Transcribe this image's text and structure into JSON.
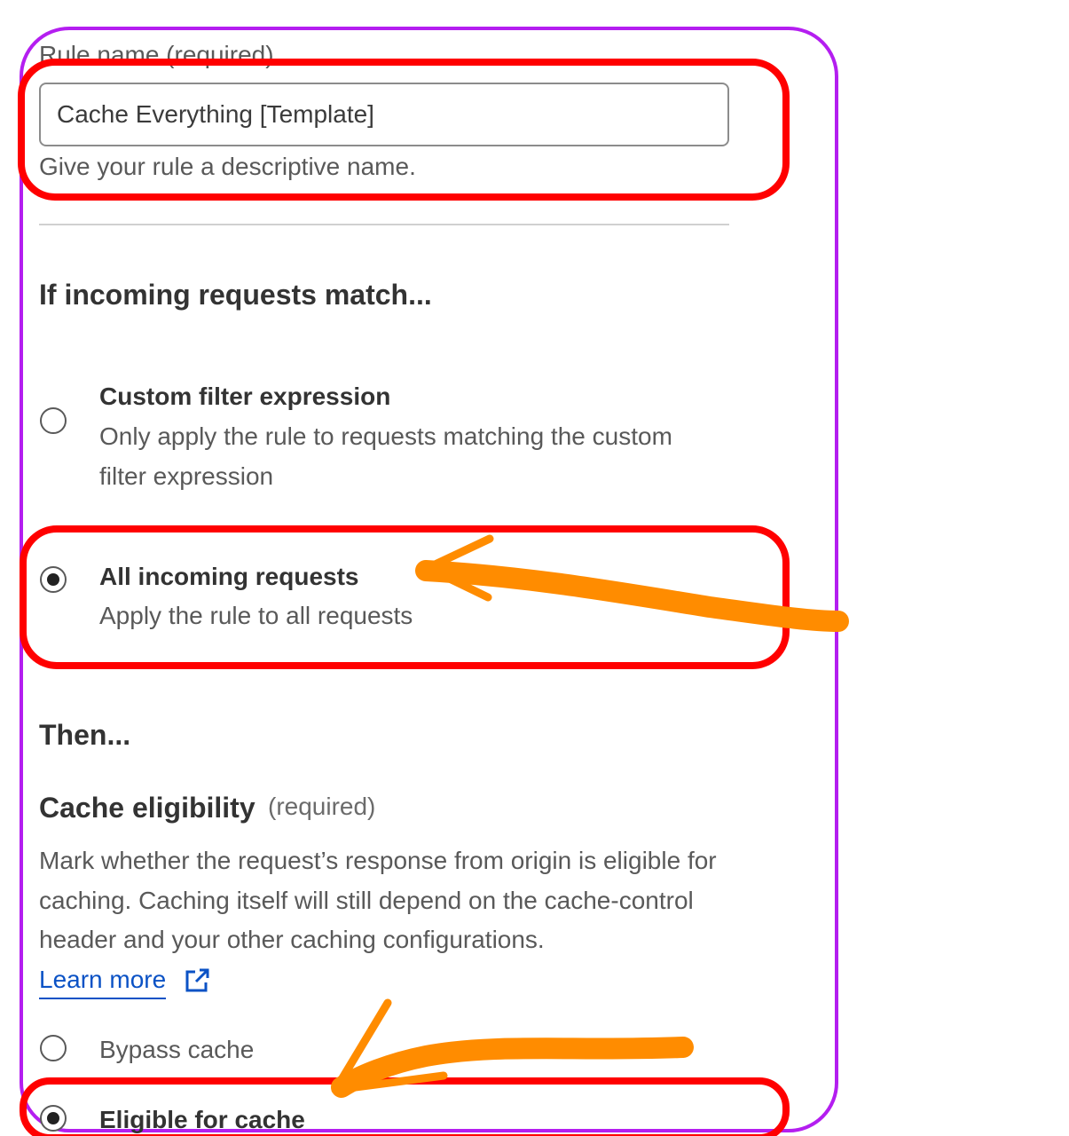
{
  "rule_name": {
    "label": "Rule name (required)",
    "value": "Cache Everything [Template]",
    "help": "Give your rule a descriptive name."
  },
  "match": {
    "heading": "If incoming requests match...",
    "options": [
      {
        "title": "Custom filter expression",
        "desc": "Only apply the rule to requests matching the custom filter expression",
        "selected": false
      },
      {
        "title": "All incoming requests",
        "desc": "Apply the rule to all requests",
        "selected": true
      }
    ]
  },
  "then": {
    "heading": "Then...",
    "cache_eligibility": {
      "title": "Cache eligibility",
      "required": "(required)",
      "description": "Mark whether the request’s response from origin is eligible for caching. Caching itself will still depend on the cache-control header and your other caching configurations.",
      "learn_more": "Learn more",
      "learn_more_icon": "external-link-icon",
      "options": [
        {
          "label": "Bypass cache",
          "selected": false
        },
        {
          "label": "Eligible for cache",
          "selected": true
        }
      ]
    }
  },
  "annotations": {
    "frame_color": "#b41ef0",
    "highlight_color": "#ff0000",
    "arrow_color": "#ff8c00"
  }
}
